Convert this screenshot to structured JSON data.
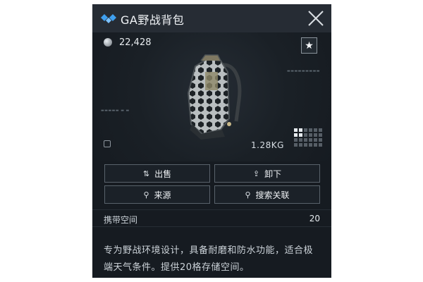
{
  "item": {
    "title": "GA野战背包",
    "price": "22,428",
    "weight": "1.28KG",
    "size_grid": {
      "cols": 6,
      "rows": 4,
      "filled_cols": 2,
      "filled_rows": 2
    }
  },
  "actions": [
    {
      "label": "出售",
      "icon": "sell-icon"
    },
    {
      "label": "卸下",
      "icon": "unload-icon"
    },
    {
      "label": "来源",
      "icon": "search-icon"
    },
    {
      "label": "搜索关联",
      "icon": "search-icon"
    }
  ],
  "stats": {
    "capacity_label": "携带空间",
    "capacity_value": "20"
  },
  "description": "专为野战环境设计，具备耐磨和防水功能，适合极端天气条件。提供20格存储空间。",
  "colors": {
    "panel_bg": "#161b21",
    "header_bg": "#262c34",
    "accent_blue": "#3fa0f0",
    "button_border": "#59626b"
  }
}
